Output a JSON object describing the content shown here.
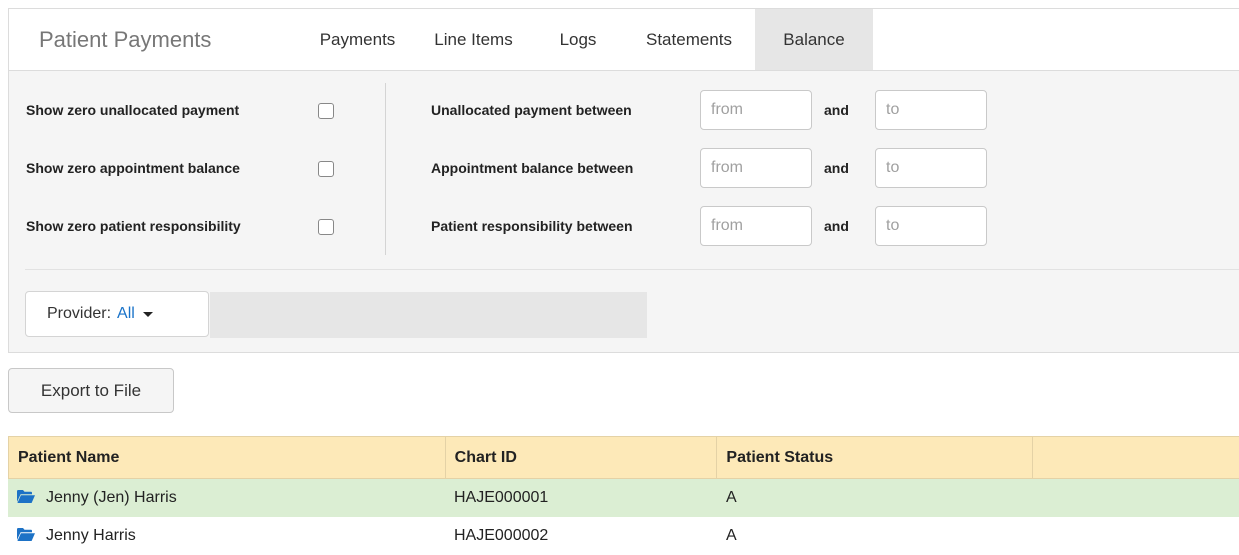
{
  "app": {
    "title": "Patient Payments"
  },
  "nav": {
    "tabs": [
      {
        "label": "Payments"
      },
      {
        "label": "Line Items"
      },
      {
        "label": "Logs"
      },
      {
        "label": "Statements"
      },
      {
        "label": "Balance"
      }
    ],
    "active_tab": "Balance"
  },
  "filters": {
    "checkboxes": [
      {
        "label": "Show zero unallocated payment",
        "checked": false
      },
      {
        "label": "Show zero appointment balance",
        "checked": false
      },
      {
        "label": "Show zero patient responsibility",
        "checked": false
      }
    ],
    "ranges": [
      {
        "label": "Unallocated payment between",
        "from_placeholder": "from",
        "and_label": "and",
        "to_placeholder": "to"
      },
      {
        "label": "Appointment balance between",
        "from_placeholder": "from",
        "and_label": "and",
        "to_placeholder": "to"
      },
      {
        "label": "Patient responsibility between",
        "from_placeholder": "from",
        "and_label": "and",
        "to_placeholder": "to"
      }
    ],
    "provider": {
      "label": "Provider:",
      "value": "All"
    }
  },
  "actions": {
    "export_label": "Export to File"
  },
  "table": {
    "columns": [
      "Patient Name",
      "Chart ID",
      "Patient Status",
      ""
    ],
    "rows": [
      {
        "name": "Jenny (Jen) Harris",
        "chart_id": "HAJE000001",
        "status": "A"
      },
      {
        "name": "Jenny Harris",
        "chart_id": "HAJE000002",
        "status": "A"
      }
    ]
  },
  "colors": {
    "accent_link": "#1a73c9",
    "table_header": "#fde9b8",
    "row_highlight": "#dbeed3",
    "folder_icon": "#1d72c6"
  },
  "icons": {
    "row_icon": "folder-open-icon",
    "dropdown": "caret-down-icon"
  }
}
